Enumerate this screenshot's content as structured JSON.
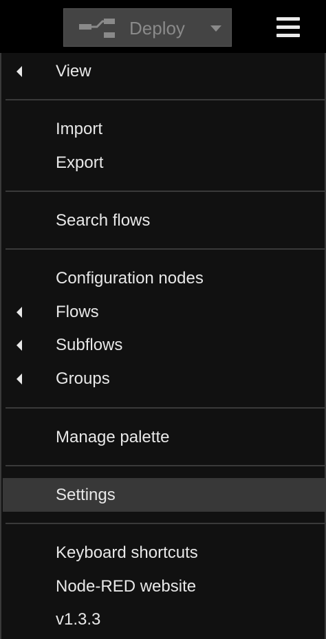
{
  "header": {
    "deploy_label": "Deploy"
  },
  "menu": {
    "view": "View",
    "import": "Import",
    "export": "Export",
    "search_flows": "Search flows",
    "configuration_nodes": "Configuration nodes",
    "flows": "Flows",
    "subflows": "Subflows",
    "groups": "Groups",
    "manage_palette": "Manage palette",
    "settings": "Settings",
    "keyboard_shortcuts": "Keyboard shortcuts",
    "website": "Node-RED website",
    "version": "v1.3.3"
  },
  "colors": {
    "background": "#000000",
    "menu_background": "#111111",
    "highlight": "#383838",
    "deploy_button": "#444444",
    "text": "#e8e8e8"
  },
  "icons": {
    "deploy": "deploy-icon",
    "deploy_menu": "chevron-down-icon",
    "main_menu": "hamburger-menu-icon",
    "submenu": "caret-left-icon"
  }
}
